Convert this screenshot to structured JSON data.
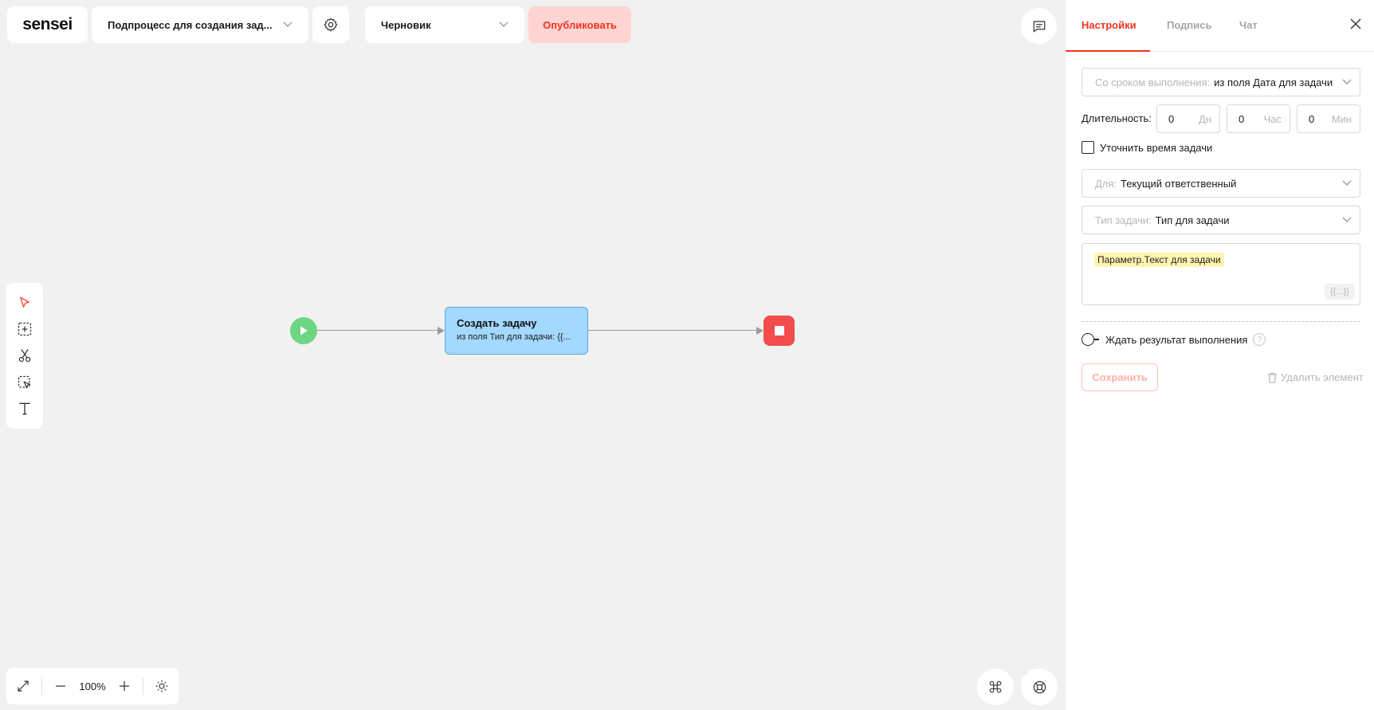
{
  "header": {
    "logo": "sensei",
    "process_name": "Подпроцесс для создания зад...",
    "status_value": "Черновик",
    "publish_label": "Опубликовать"
  },
  "canvas": {
    "task_title": "Создать задачу",
    "task_subtitle": "из поля Тип для задачи: {{..."
  },
  "zoom": {
    "level": "100%"
  },
  "panel": {
    "tabs": [
      "Настройки",
      "Подпись",
      "Чат"
    ],
    "active_tab": "Настройки",
    "due_label": "Со сроком выполнения:",
    "due_value": "из поля Дата для задачи",
    "duration_label": "Длительность:",
    "duration": [
      {
        "value": "0",
        "unit": "Дн"
      },
      {
        "value": "0",
        "unit": "Час"
      },
      {
        "value": "0",
        "unit": "Мин"
      }
    ],
    "refine_time_label": "Уточнить время задачи",
    "for_label": "Для:",
    "for_value": "Текущий ответственный",
    "task_type_label": "Тип задачи:",
    "task_type_value": "Тип для задачи",
    "text_chip": "Параметр.Текст для задачи",
    "var_button": "{{...}}",
    "wait_result_label": "Ждать результат выполнения",
    "help_symbol": "?",
    "save_label": "Сохранить",
    "delete_label": "Удалить элемент"
  },
  "colors": {
    "accent": "#f0341f",
    "start_node": "#6ed582",
    "task_node": "#a3d8ff",
    "end_node": "#f24c4c"
  },
  "icons": [
    "settings-icon",
    "chevron-down-icon",
    "comment-icon",
    "pointer-icon",
    "add-frame-icon",
    "scissors-icon",
    "select-area-icon",
    "text-icon",
    "expand-icon",
    "minus-icon",
    "plus-icon",
    "sun-icon",
    "command-icon",
    "lifebuoy-icon",
    "close-icon",
    "trash-icon"
  ]
}
